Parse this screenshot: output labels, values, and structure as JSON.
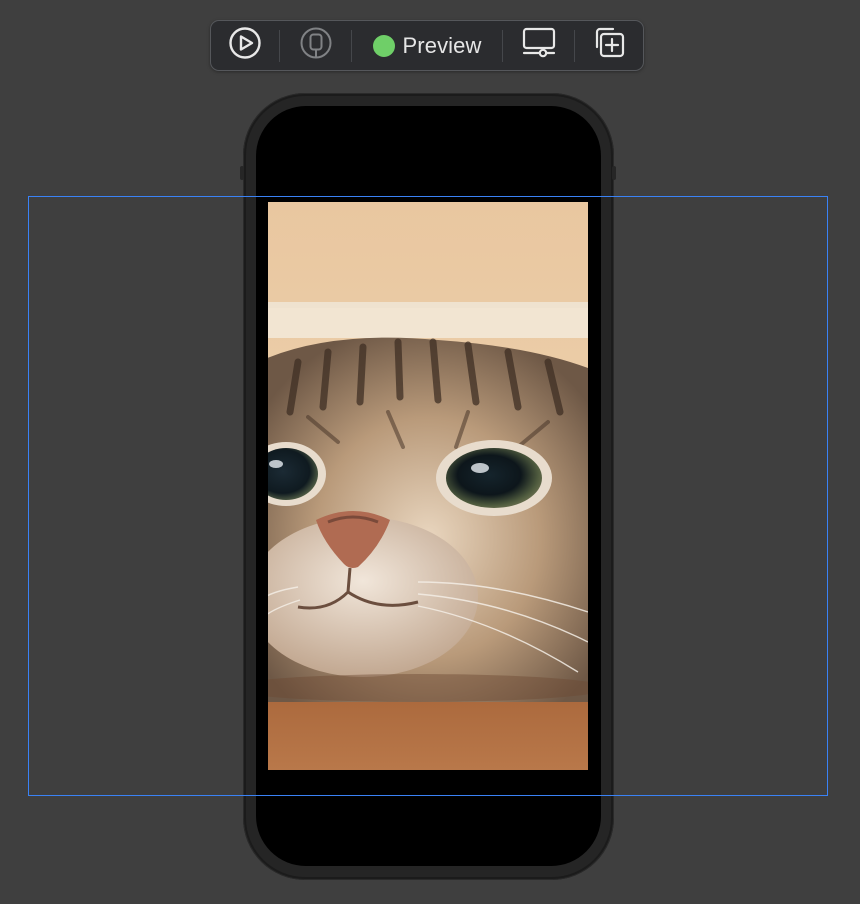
{
  "toolbar": {
    "preview_label": "Preview",
    "status_color": "#6fcf68",
    "icons": {
      "live": "play-circle-icon",
      "device": "device-selectable-icon",
      "status": "status-dot",
      "display": "device-settings-icon",
      "duplicate": "duplicate-preview-icon"
    }
  },
  "canvas": {
    "selection_color": "#3a82f6"
  },
  "preview": {
    "content": "cat-photo"
  }
}
